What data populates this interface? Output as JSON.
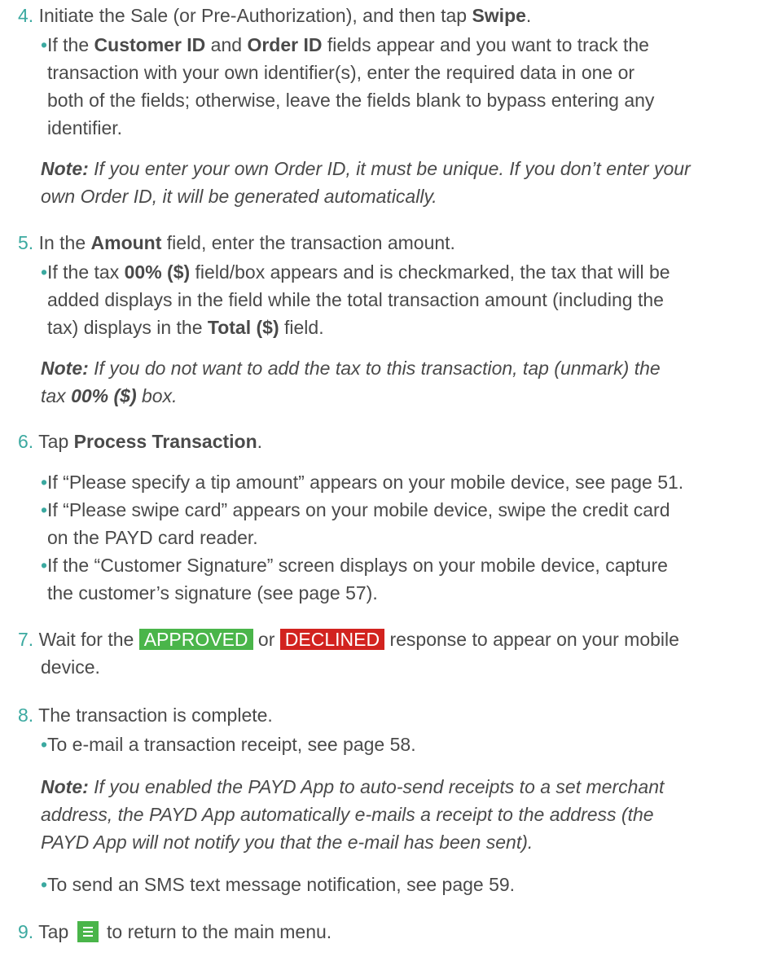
{
  "steps": {
    "s4": {
      "num": "4.",
      "text_pre": "Initiate the Sale (or Pre-Authorization), and then tap ",
      "text_bold": "Swipe",
      "text_post": ".",
      "bullet": {
        "l1_pre": "If the ",
        "l1_b1": "Customer ID",
        "l1_mid": " and ",
        "l1_b2": "Order ID",
        "l1_post": " fields appear and you want to track the",
        "l2": "transaction with your own identifier(s), enter the required data in one or",
        "l3": "both of the fields; otherwise, leave the fields blank to bypass entering any",
        "l4": "identifier."
      },
      "note": {
        "label": "Note:",
        "l1": " If you enter your own Order ID, it must be unique. If you don’t enter your",
        "l2": "own Order ID, it will be generated automatically."
      }
    },
    "s5": {
      "num": "5.",
      "text_pre": "In the ",
      "text_bold": "Amount",
      "text_post": " field, enter the transaction amount.",
      "bullet": {
        "l1_pre": "If the tax ",
        "l1_b1": "00% ($)",
        "l1_post": " field/box appears and is checkmarked, the tax that will be",
        "l2": "added displays in the field while the total transaction amount (including the",
        "l3_pre": "tax) displays in the ",
        "l3_b": "Total ($)",
        "l3_post": " field."
      },
      "note": {
        "label": "Note:",
        "l1": " If you do not want to add the tax to this transaction, tap (unmark) the",
        "l2_pre": "tax ",
        "l2_b": "00% ($)",
        "l2_post": " box."
      }
    },
    "s6": {
      "num": "6.",
      "text_pre": "Tap ",
      "text_bold": "Process Transaction",
      "text_post": ".",
      "b1": "If “Please specify a tip amount” appears on your mobile device, see page 51.",
      "b2_l1": "If “Please swipe card” appears on your mobile device, swipe the credit card",
      "b2_l2": "on the PAYD card reader.",
      "b3_l1": "If the “Customer Signature” screen displays on your mobile device, capture",
      "b3_l2": "the customer’s signature (see page 57)."
    },
    "s7": {
      "num": "7.",
      "text_pre": "Wait for the ",
      "approved": "APPROVED",
      "or": " or ",
      "declined": "DECLINED",
      "text_post": " response to appear on your mobile",
      "l2": "device."
    },
    "s8": {
      "num": "8.",
      "text": "The transaction is complete.",
      "b1": "To e-mail a transaction receipt, see page 58.",
      "note": {
        "label": "Note:",
        "l1": " If you enabled the PAYD App to auto-send receipts to a set merchant",
        "l2": "address, the PAYD App automatically e-mails a receipt to the address (the",
        "l3": "PAYD App will not notify you that the e-mail has been sent)."
      },
      "b2": "To send an SMS text message notification, see page 59."
    },
    "s9": {
      "num": "9.",
      "text_pre": "Tap ",
      "icon": "menu-icon",
      "text_post": " to return to the main menu."
    }
  },
  "colors": {
    "number_accent": "#3ba9a0",
    "approved_badge": "#4ab54a",
    "declined_badge": "#d2231f",
    "text": "#4a4a4a"
  }
}
